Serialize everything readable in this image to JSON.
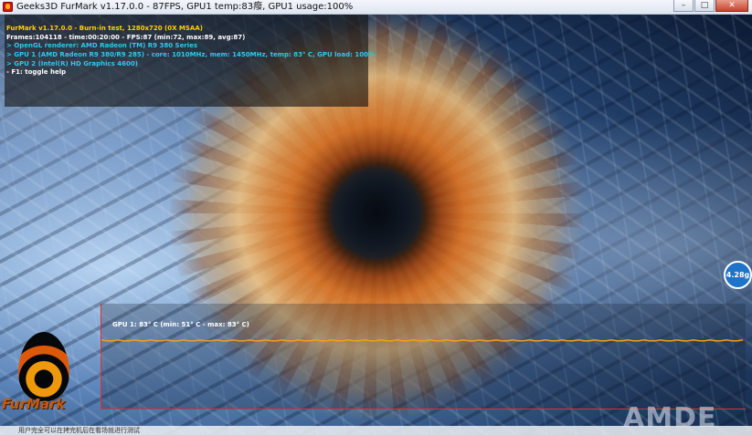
{
  "window": {
    "title": "Geeks3D FurMark v1.17.0.0 - 87FPS, GPU1 temp:83癈, GPU1 usage:100%",
    "buttons": {
      "minimize": "–",
      "maximize": "□",
      "close": "✕"
    }
  },
  "overlay": {
    "lines": [
      "FurMark v1.17.0.0 - Burn-in test, 1280x720 (0X MSAA)",
      "Frames:104118 - time:00:20:00 - FPS:87 (min:72, max:89, avg:87)",
      "> OpenGL renderer: AMD Radeon (TM) R9 380 Series",
      "> GPU 1 (AMD Radeon R9 380/R9 285) - core: 1010MHz, mem: 1450MHz, temp: 83° C, GPU load: 100%",
      "> GPU 2 (Intel(R) HD Graphics 4600)",
      "- F1: toggle help"
    ]
  },
  "graph": {
    "label": "GPU 1: 83° C (min: 51° C - max: 83° C)",
    "current_temp_c": 83,
    "min_temp_c": 51,
    "max_temp_c": 83,
    "line_color": "#f0a020",
    "axis_color": "#e03030"
  },
  "badge": {
    "text": "4.28g"
  },
  "logo": {
    "text": "FurMark"
  },
  "watermark": {
    "text": "AMDE"
  },
  "bottom": {
    "text": "用户完全可以在拷完机后在看场就进行测试"
  },
  "colors": {
    "title_yellow": "#ffd200",
    "info_cyan": "#2fc9ef",
    "accent_red": "#d8171b"
  }
}
